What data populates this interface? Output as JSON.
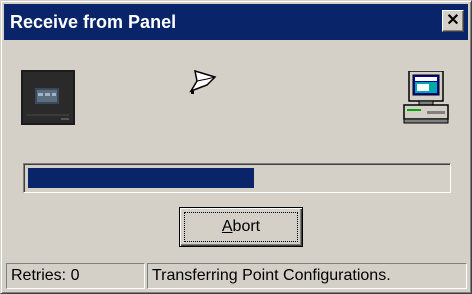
{
  "window": {
    "title": "Receive from Panel",
    "close_label": "✕"
  },
  "icons": {
    "source": "panel-device-icon",
    "transfer": "paper-sheet-icon",
    "destination": "computer-icon"
  },
  "progress": {
    "fraction": 0.54
  },
  "buttons": {
    "abort_mnemonic": "A",
    "abort_rest": "bort"
  },
  "status": {
    "retries": "Retries: 0",
    "message": "Transferring Point Configurations."
  },
  "colors": {
    "title_bar": "#0a246a",
    "progress_fill": "#0a246a",
    "face": "#d4d0c8"
  }
}
